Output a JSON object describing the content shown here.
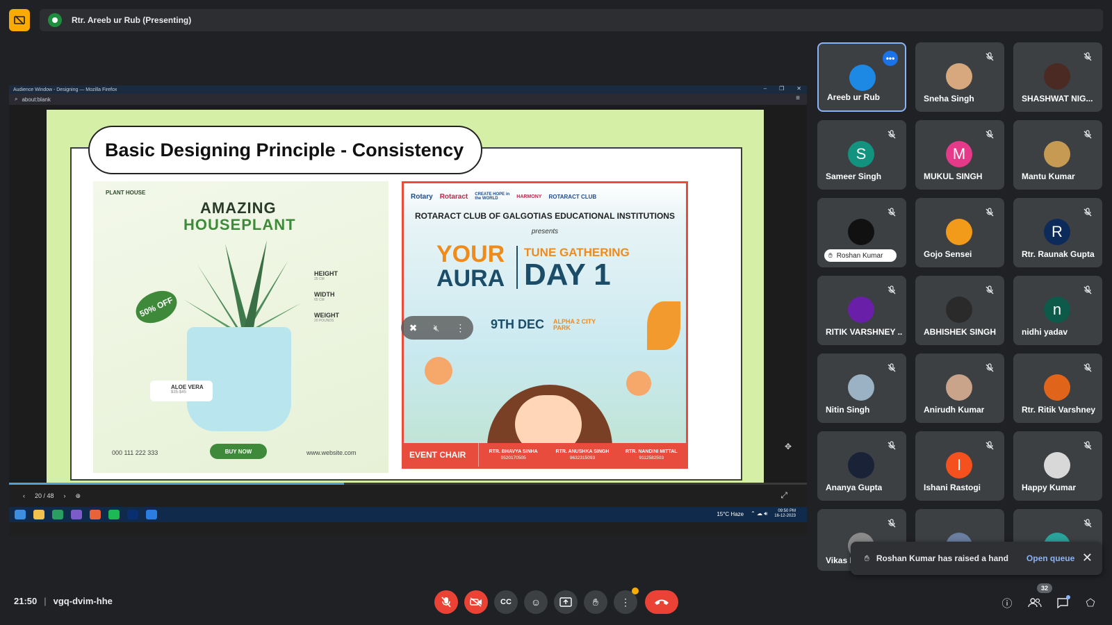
{
  "header": {
    "presenting_label": "Rtr. Areeb ur Rub (Presenting)"
  },
  "shared_screen": {
    "firefox_title": "Audience Window - Designing — Mozilla Firefox",
    "url": "about:blank",
    "slide_title": "Basic Designing Principle - Consistency",
    "page_indicator": "20 / 48",
    "progress_fraction": 0.42,
    "plant_ad": {
      "brand": "PLANT HOUSE",
      "title_line1": "AMAZING",
      "title_line2": "HOUSEPLANT",
      "sale": "50% OFF",
      "spec_height": "HEIGHT",
      "spec_height_val": "25 CM",
      "spec_width": "WIDTH",
      "spec_width_val": "65 CM",
      "spec_weight": "WEIGHT",
      "spec_weight_val": "20 POUNDS",
      "tag_name": "ALOE VERA",
      "tag_price": "$35-$45",
      "phone": "000 111 222 333",
      "buy": "BUY NOW",
      "website": "www.website.com"
    },
    "event_poster": {
      "logo_rotary": "Rotary",
      "logo_rotaract": "Rotaract",
      "logo_hope": "CREATE HOPE in the WORLD",
      "logo_harmony": "HARMONY",
      "logo_club": "ROTARACT CLUB",
      "club": "ROTARACT CLUB OF GALGOTIAS EDUCATIONAL INSTITUTIONS",
      "presents": "presents",
      "your": "YOUR",
      "aura": "AURA",
      "tune": "TUNE GATHERING",
      "day": "DAY 1",
      "date": "9TH DEC",
      "venue": "ALPHA 2 CITY PARK",
      "event_chair": "EVENT CHAIR",
      "people": [
        {
          "name": "RTR. BHAVYA SINHA",
          "phone": "9520170505"
        },
        {
          "name": "RTR. ANUSHKA SINGH",
          "phone": "9632315093"
        },
        {
          "name": "RTR. NANDINI MITTAL",
          "phone": "9112582503"
        }
      ]
    },
    "taskbar": {
      "weather": "15°C Haze",
      "time": "09:50 PM",
      "date": "16-12-2023"
    }
  },
  "participants": [
    {
      "name": "Areeb ur Rub",
      "initial": "",
      "color": "#1e88e5"
    },
    {
      "name": "Sneha Singh",
      "initial": "",
      "color": "#d7a77d"
    },
    {
      "name": "SHASHWAT NIG...",
      "initial": "",
      "color": "#4a2a22"
    },
    {
      "name": "Sameer Singh",
      "initial": "S",
      "color": "#12937f"
    },
    {
      "name": "MUKUL SINGH",
      "initial": "M",
      "color": "#e5398a"
    },
    {
      "name": "Mantu Kumar",
      "initial": "",
      "color": "#c69a52"
    },
    {
      "name": "Roshan Kumar",
      "initial": "",
      "color": "#111111"
    },
    {
      "name": "Gojo Sensei",
      "initial": "",
      "color": "#f29b1a"
    },
    {
      "name": "Rtr. Raunak Gupta",
      "initial": "R",
      "color": "#0d2b5a"
    },
    {
      "name": "RITIK VARSHNEY ...",
      "initial": "",
      "color": "#6a1fa8"
    },
    {
      "name": "ABHISHEK SINGH",
      "initial": "",
      "color": "#2a2a2a"
    },
    {
      "name": "nidhi yadav",
      "initial": "n",
      "color": "#0d5a4a"
    },
    {
      "name": "Nitin Singh",
      "initial": "",
      "color": "#9bb2c4"
    },
    {
      "name": "Anirudh Kumar",
      "initial": "",
      "color": "#c9a48a"
    },
    {
      "name": "Rtr. Ritik Varshney",
      "initial": "",
      "color": "#e0641a"
    },
    {
      "name": "Ananya Gupta",
      "initial": "",
      "color": "#1a2238"
    },
    {
      "name": "Ishani Rastogi",
      "initial": "I",
      "color": "#f4511e"
    },
    {
      "name": "Happy Kumar",
      "initial": "",
      "color": "#d8d8d8"
    },
    {
      "name": "Vikas N",
      "initial": "",
      "color": "#8a8a8a"
    },
    {
      "name": "",
      "initial": "",
      "color": "#6a7ea0"
    },
    {
      "name": "",
      "initial": "",
      "color": "#2aa39a"
    }
  ],
  "hand_pill_label": "Roshan Kumar",
  "toast": {
    "message": "Roshan Kumar has raised a hand",
    "action": "Open queue"
  },
  "bottom": {
    "time": "21:50",
    "meeting_code": "vgq-dvim-hhe",
    "people_count": "32"
  },
  "colors": {
    "accent": "#8ab4f8",
    "danger": "#ea4335",
    "present": "#f9ab00",
    "bg": "#202124",
    "tile": "#3c4043"
  }
}
